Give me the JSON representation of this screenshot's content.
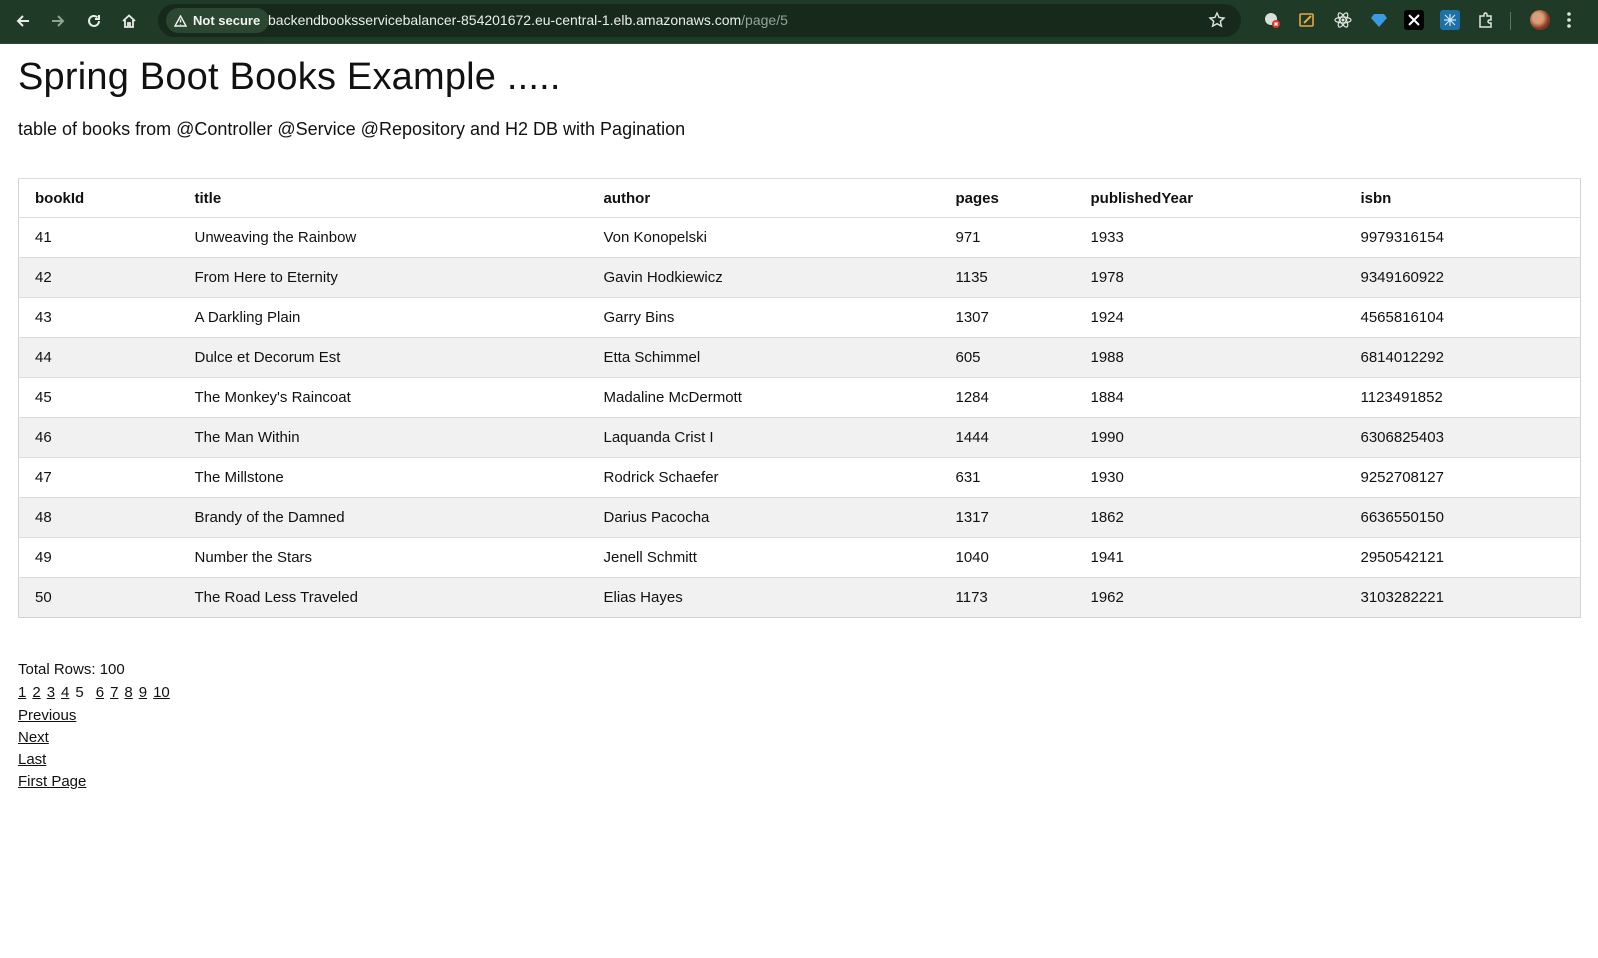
{
  "browser": {
    "security_label": "Not secure",
    "url_host": "backendbooksservicebalancer-854201672.eu-central-1.elb.amazonaws.com",
    "url_path": "/page/5"
  },
  "page": {
    "title": "Spring Boot Books Example .....",
    "subtitle": "table of books from @Controller @Service @Repository and H2 DB with Pagination"
  },
  "table": {
    "headers": [
      "bookId",
      "title",
      "author",
      "pages",
      "publishedYear",
      "isbn"
    ],
    "rows": [
      [
        "41",
        "Unweaving the Rainbow",
        "Von Konopelski",
        "971",
        "1933",
        "9979316154"
      ],
      [
        "42",
        "From Here to Eternity",
        "Gavin Hodkiewicz",
        "1135",
        "1978",
        "9349160922"
      ],
      [
        "43",
        "A Darkling Plain",
        "Garry Bins",
        "1307",
        "1924",
        "4565816104"
      ],
      [
        "44",
        "Dulce et Decorum Est",
        "Etta Schimmel",
        "605",
        "1988",
        "6814012292"
      ],
      [
        "45",
        "The Monkey's Raincoat",
        "Madaline McDermott",
        "1284",
        "1884",
        "1123491852"
      ],
      [
        "46",
        "The Man Within",
        "Laquanda Crist I",
        "1444",
        "1990",
        "6306825403"
      ],
      [
        "47",
        "The Millstone",
        "Rodrick Schaefer",
        "631",
        "1930",
        "9252708127"
      ],
      [
        "48",
        "Brandy of the Damned",
        "Darius Pacocha",
        "1317",
        "1862",
        "6636550150"
      ],
      [
        "49",
        "Number the Stars",
        "Jenell Schmitt",
        "1040",
        "1941",
        "2950542121"
      ],
      [
        "50",
        "The Road Less Traveled",
        "Elias Hayes",
        "1173",
        "1962",
        "3103282221"
      ]
    ]
  },
  "pagination": {
    "total_rows": "Total Rows: 100",
    "pages": [
      "1",
      "2",
      "3",
      "4",
      "5",
      "6",
      "7",
      "8",
      "9",
      "10"
    ],
    "current_page": "5",
    "previous": "Previous",
    "next": "Next",
    "last": "Last",
    "first": "First Page"
  }
}
